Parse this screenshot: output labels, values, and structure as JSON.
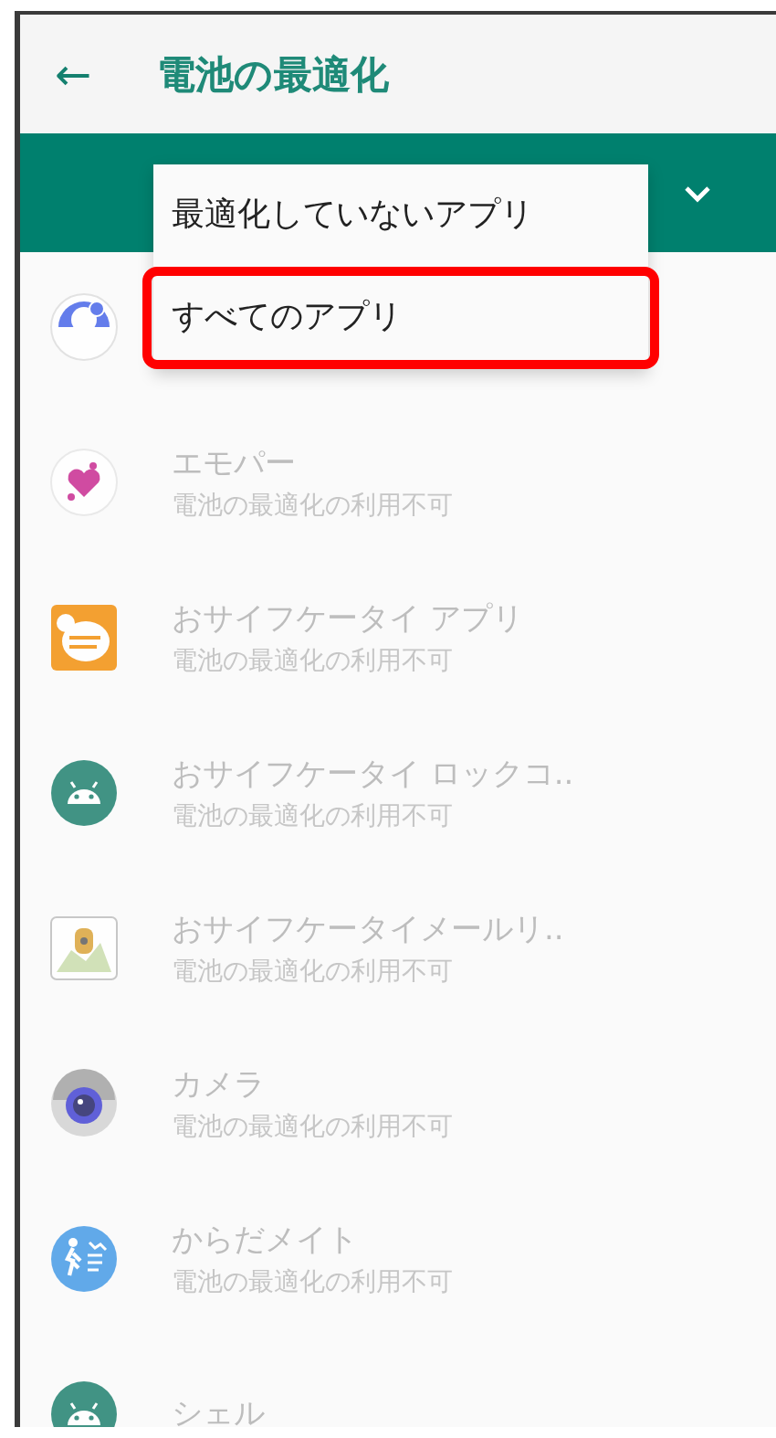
{
  "header": {
    "back": "←",
    "title": "電池の最適化"
  },
  "filter_dropdown": {
    "options": [
      {
        "label": "最適化していないアプリ",
        "highlighted": false
      },
      {
        "label": "すべてのアプリ",
        "highlighted": true
      }
    ]
  },
  "apps": [
    {
      "kind": "chat",
      "disabled": true
    },
    {
      "kind": "heart",
      "title": "エモパー",
      "subtitle": "電池の最適化の利用不可",
      "disabled": true
    },
    {
      "kind": "wallet",
      "title": "おサイフケータイ アプリ",
      "subtitle": "電池の最適化の利用不可",
      "disabled": true
    },
    {
      "kind": "android",
      "title": "おサイフケータイ ロックコ..",
      "subtitle": "電池の最適化の利用不可",
      "disabled": true
    },
    {
      "kind": "map",
      "title": "おサイフケータイメールリ..",
      "subtitle": "電池の最適化の利用不可",
      "disabled": true
    },
    {
      "kind": "camera",
      "title": "カメラ",
      "subtitle": "電池の最適化の利用不可",
      "disabled": true
    },
    {
      "kind": "walker",
      "title": "からだメイト",
      "subtitle": "電池の最適化の利用不可",
      "disabled": true
    },
    {
      "kind": "android",
      "title": "シェル",
      "disabled": true
    }
  ]
}
